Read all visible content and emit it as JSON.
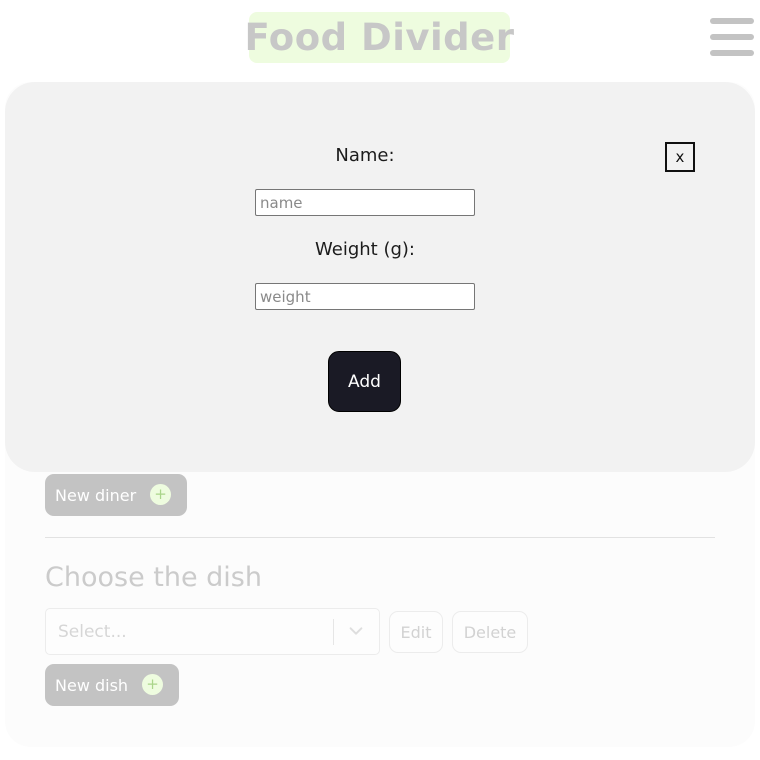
{
  "header": {
    "app_title": "Food Divider",
    "menu_icon": "hamburger-menu-icon"
  },
  "modal": {
    "name_label": "Name:",
    "name_placeholder": "name",
    "weight_label": "Weight (g):",
    "weight_placeholder": "weight",
    "add_label": "Add",
    "close_label": "x"
  },
  "diners": {
    "new_diner_label": "New diner",
    "plus_icon": "plus-circle-icon",
    "plus_glyph": "+"
  },
  "dishes": {
    "section_title": "Choose the dish",
    "select_placeholder": "Select...",
    "chevron_icon": "chevron-down-icon",
    "edit_label": "Edit",
    "delete_label": "Delete",
    "new_dish_label": "New dish"
  },
  "colors": {
    "accent_light": "#eefcdf",
    "button_dark": "#1a1a25",
    "disabled_gray": "#c3c3c3",
    "modal_bg": "#f2f2f2"
  }
}
